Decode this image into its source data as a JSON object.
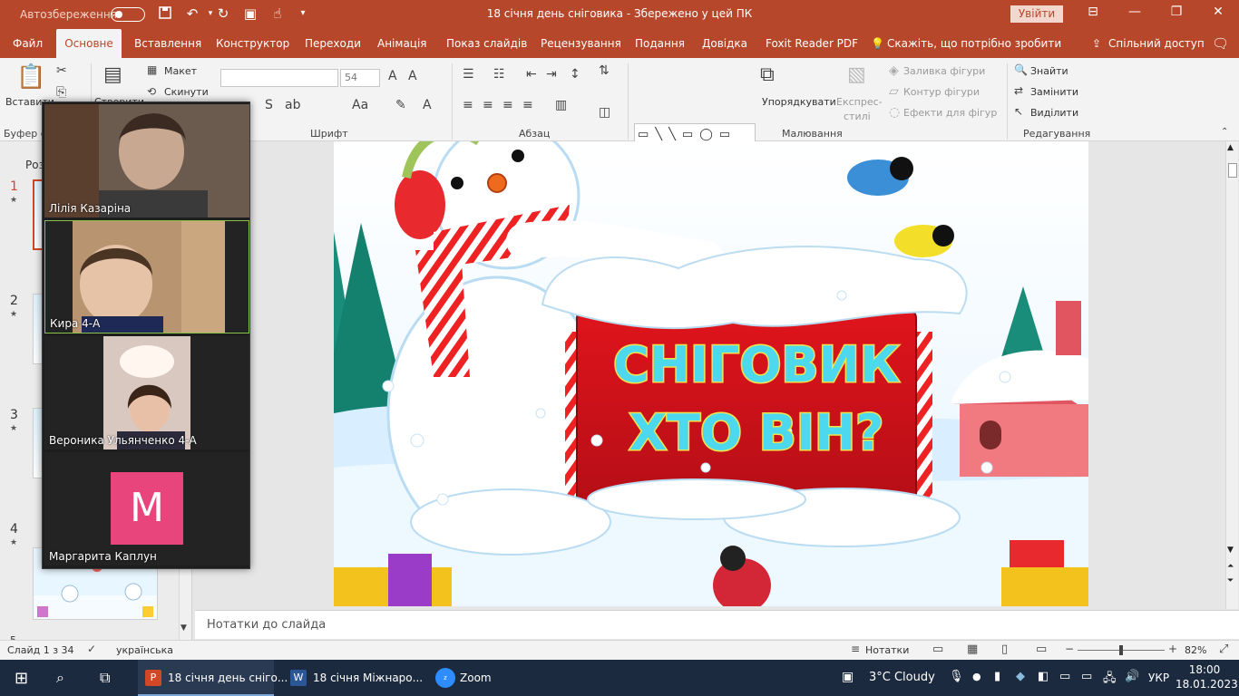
{
  "titlebar": {
    "autosave_label": "Автозбереження",
    "doc_title": "18 січня день сніговика  -  Збережено у цей ПК",
    "signin_label": "Увійти",
    "bg": "#b7472a"
  },
  "tabs": [
    {
      "label": "Файл"
    },
    {
      "label": "Основне"
    },
    {
      "label": "Вставлення"
    },
    {
      "label": "Конструктор"
    },
    {
      "label": "Переходи"
    },
    {
      "label": "Анімація"
    },
    {
      "label": "Показ слайдів"
    },
    {
      "label": "Рецензування"
    },
    {
      "label": "Подання"
    },
    {
      "label": "Довідка"
    },
    {
      "label": "Foxit Reader PDF"
    },
    {
      "label": "Скажіть, що потрібно зробити"
    }
  ],
  "share_label": "Спільний доступ",
  "ribbon": {
    "paste": "Вставити",
    "clipboard_group": "Буфер о",
    "new_slide": "Створити",
    "layout": "Макет",
    "reset": "Скинути",
    "font_size": "54",
    "font_group": "Шрифт",
    "paragraph_group": "Абзац",
    "arrange": "Упорядкувати",
    "quick_styles": "Експрес-\nстилі",
    "quick_styles_1": "Експрес-",
    "quick_styles_2": "стилі",
    "shape_fill": "Заливка фігури",
    "shape_outline": "Контур фігури",
    "shape_effects": "Ефекти для фігур",
    "drawing_group": "Малювання",
    "find": "Знайти",
    "replace": "Замінити",
    "select": "Виділити",
    "editing_group": "Редагування"
  },
  "thumbnails": {
    "section_label": "Роз",
    "items": [
      {
        "num": "1"
      },
      {
        "num": "2"
      },
      {
        "num": "3"
      },
      {
        "num": "4"
      },
      {
        "num": "5"
      }
    ]
  },
  "slide": {
    "line1": "СНІГОВИК",
    "line2": "ХТО ВІН?",
    "text_color": "#4ed8ee",
    "board_color": "#d8171f"
  },
  "notes": {
    "placeholder": "Нотатки до слайда"
  },
  "zoom": {
    "participants": [
      {
        "name": "Лілія Казаріна"
      },
      {
        "name": "Кира 4-А"
      },
      {
        "name": "Вероника Ульянченко 4-А"
      },
      {
        "name": "Маргарита Каплун",
        "initial": "M",
        "avatar_color": "#e8457c"
      }
    ]
  },
  "status": {
    "slide_counter": "Слайд 1 з 34",
    "language": "українська",
    "notes_label": "Нотатки",
    "zoom_level": "82%",
    "zoom_fraction": 0.5
  },
  "taskbar": {
    "apps": [
      {
        "label": "18 січня день сніго..."
      },
      {
        "label": "18 січня  Міжнаро..."
      },
      {
        "label": "Zoom"
      }
    ],
    "weather": "3°C  Cloudy",
    "lang": "УКР",
    "time": "18:00",
    "date": "18.01.2023"
  }
}
